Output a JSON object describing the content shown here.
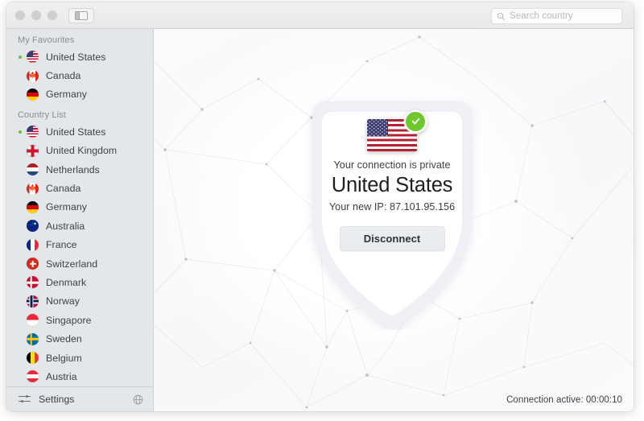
{
  "window": {
    "traffic_lights": [
      "close",
      "minimize",
      "zoom"
    ],
    "sidebar_toggle_name": "sidebar-toggle"
  },
  "search": {
    "placeholder": "Search country",
    "value": "",
    "icon": "search-icon"
  },
  "sidebar": {
    "sections": [
      {
        "title": "My Favourites",
        "items": [
          {
            "label": "United States",
            "flag": "f-us",
            "active": true
          },
          {
            "label": "Canada",
            "flag": "f-ca",
            "active": false
          },
          {
            "label": "Germany",
            "flag": "f-de",
            "active": false
          }
        ]
      },
      {
        "title": "Country List",
        "items": [
          {
            "label": "United States",
            "flag": "f-us",
            "active": true
          },
          {
            "label": "United Kingdom",
            "flag": "f-uk",
            "active": false
          },
          {
            "label": "Netherlands",
            "flag": "f-nl",
            "active": false
          },
          {
            "label": "Canada",
            "flag": "f-ca",
            "active": false
          },
          {
            "label": "Germany",
            "flag": "f-de",
            "active": false
          },
          {
            "label": "Australia",
            "flag": "f-au",
            "active": false
          },
          {
            "label": "France",
            "flag": "f-fr",
            "active": false
          },
          {
            "label": "Switzerland",
            "flag": "f-ch",
            "active": false
          },
          {
            "label": "Denmark",
            "flag": "f-dk",
            "active": false
          },
          {
            "label": "Norway",
            "flag": "f-no",
            "active": false
          },
          {
            "label": "Singapore",
            "flag": "f-sg",
            "active": false
          },
          {
            "label": "Sweden",
            "flag": "f-se",
            "active": false
          },
          {
            "label": "Belgium",
            "flag": "f-be",
            "active": false
          },
          {
            "label": "Austria",
            "flag": "f-at",
            "active": false
          }
        ]
      }
    ],
    "footer": {
      "label": "Settings",
      "left_icon": "sliders-icon",
      "right_icon": "globe-icon"
    }
  },
  "main": {
    "status_line": "Your connection is private",
    "country": "United States",
    "ip_line": "Your new IP: 87.101.95.156",
    "button_label": "Disconnect",
    "badge_icon": "check-badge-icon",
    "flag_icon": "us-flag-icon"
  },
  "statusbar": {
    "text": "Connection active: 00:00:10"
  },
  "colors": {
    "accent_green": "#6fc72e",
    "status_dot_green": "#6bbf3a",
    "sidebar_bg": "#e4e7e9",
    "shield_fill": "#ffffff",
    "shield_ring": "#eef0f6"
  }
}
